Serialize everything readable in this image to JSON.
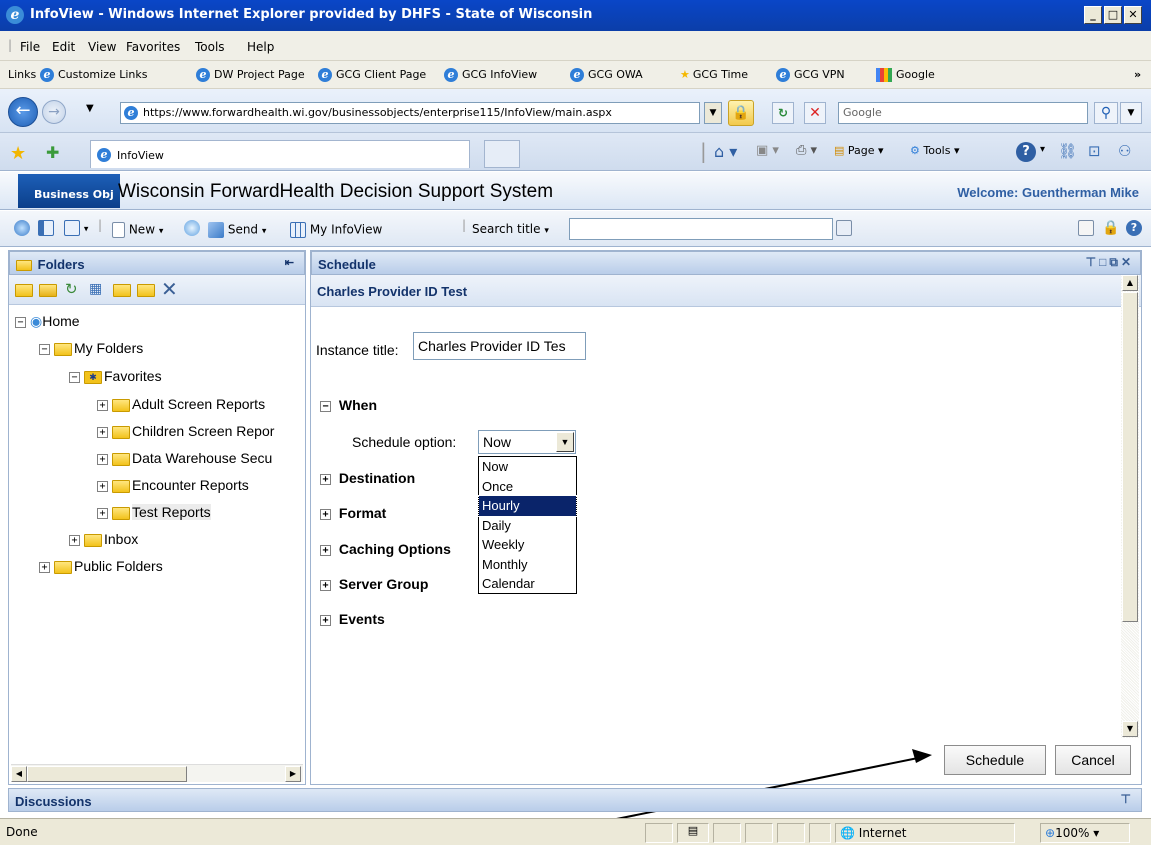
{
  "window": {
    "title": "InfoView - Windows Internet Explorer provided by DHFS - State of Wisconsin"
  },
  "menu": [
    "File",
    "Edit",
    "View",
    "Favorites",
    "Tools",
    "Help"
  ],
  "links": {
    "label": "Links",
    "items": [
      "Customize Links",
      "DW Project Page",
      "GCG Client Page",
      "GCG InfoView",
      "GCG OWA",
      "GCG Time",
      "GCG VPN",
      "Google"
    ],
    "overflow": "»"
  },
  "address": {
    "url": "https://www.forwardhealth.wi.gov/businessobjects/enterprise115/InfoView/main.aspx",
    "search_placeholder": "Google"
  },
  "tabs": {
    "active": "InfoView"
  },
  "ie_toolbar": {
    "page": "Page",
    "tools": "Tools"
  },
  "bo": {
    "logo": "Business Obj",
    "app_title": "Wisconsin ForwardHealth Decision Support System",
    "welcome": "Welcome: Guentherman Mike",
    "toolbar": {
      "new": "New",
      "send": "Send",
      "my_infoview": "My InfoView",
      "search_title": "Search title"
    }
  },
  "folders": {
    "header": "Folders",
    "home": "Home",
    "my_folders": "My Folders",
    "favorites": "Favorites",
    "items": [
      "Adult Screen Reports",
      "Children Screen Repor",
      "Data Warehouse Secu",
      "Encounter Reports",
      "Test Reports"
    ],
    "inbox": "Inbox",
    "public": "Public Folders"
  },
  "schedule": {
    "header": "Schedule",
    "report_name": "Charles Provider ID Test",
    "instance_label": "Instance title:",
    "instance_value": "Charles Provider ID Tes",
    "when": "When",
    "option_label": "Schedule option:",
    "option_value": "Now",
    "options": [
      "Now",
      "Once",
      "Hourly",
      "Daily",
      "Weekly",
      "Monthly",
      "Calendar"
    ],
    "highlighted": "Hourly",
    "sections": [
      "Destination",
      "Format",
      "Caching Options",
      "Server Group",
      "Events"
    ],
    "schedule_button": "Schedule",
    "cancel_button": "Cancel"
  },
  "discussions": {
    "header": "Discussions"
  },
  "status": {
    "text": "Done",
    "zone": "Internet",
    "zoom": "100%"
  }
}
